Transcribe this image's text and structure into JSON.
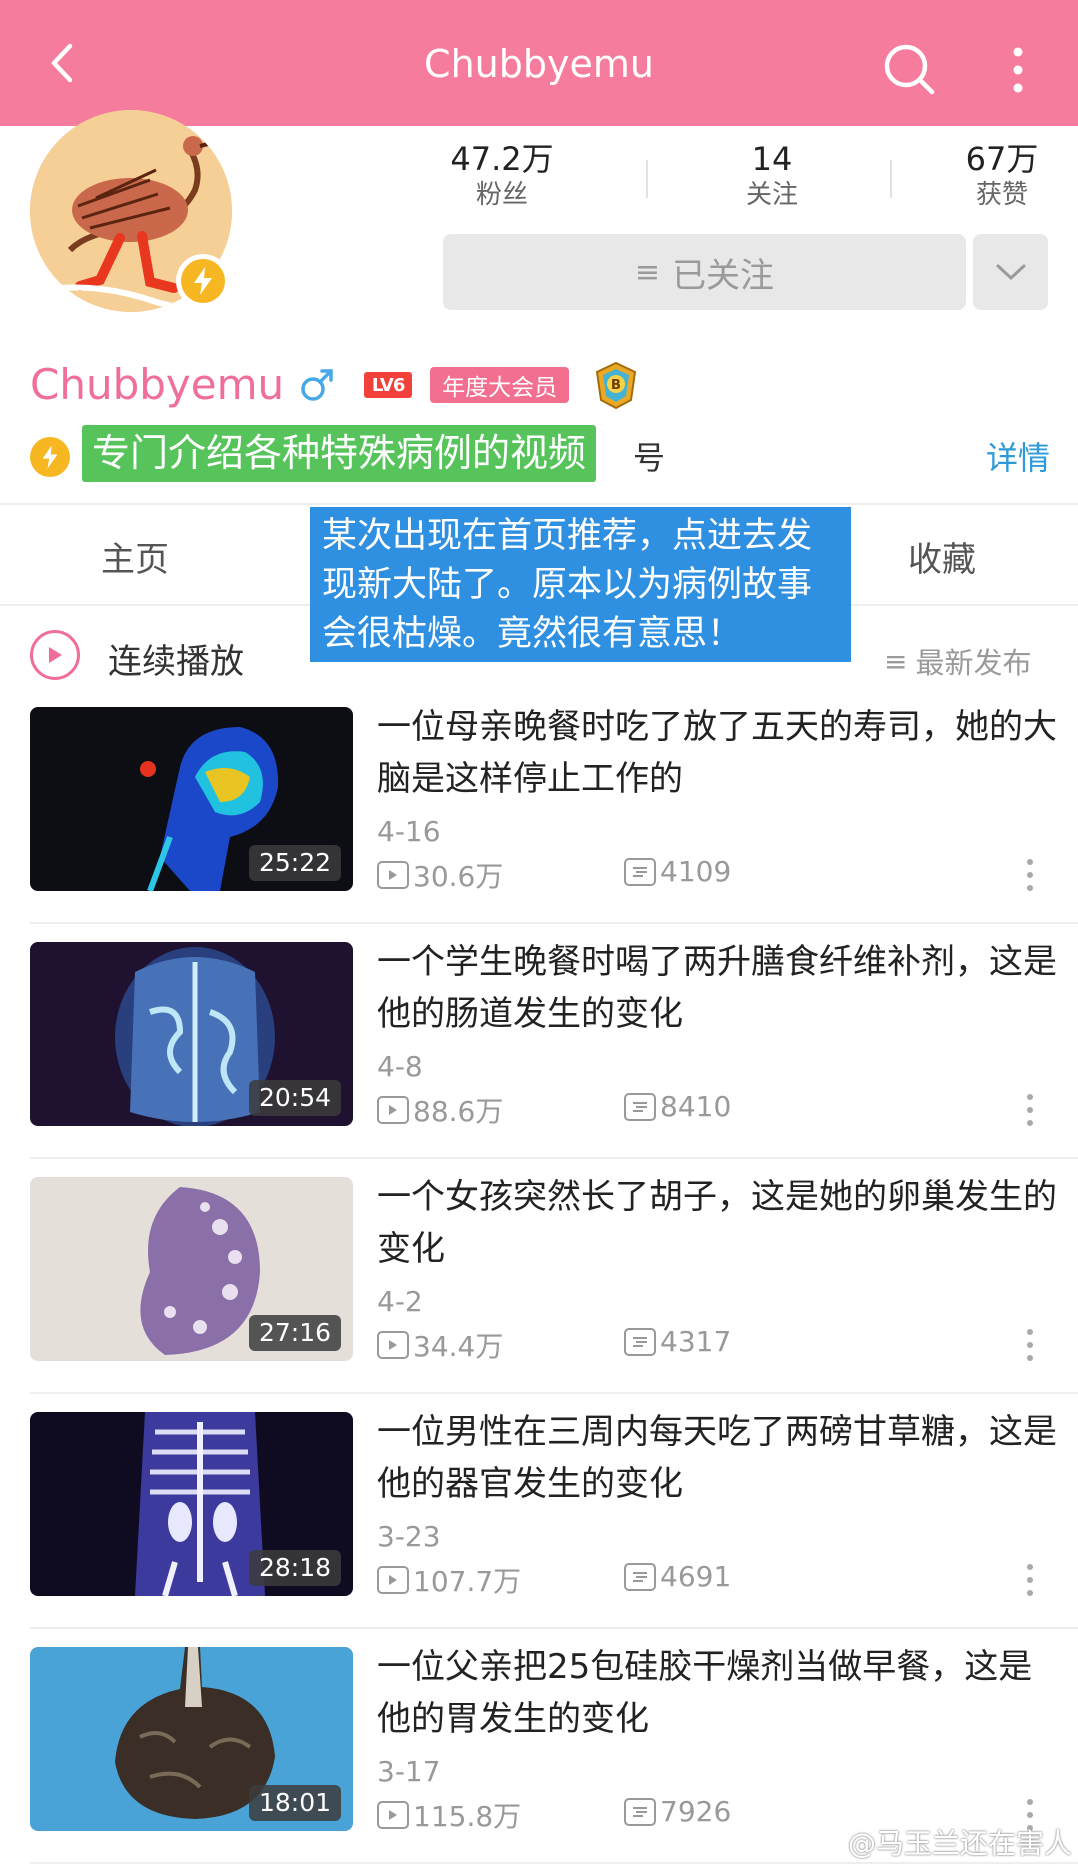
{
  "colors": {
    "brand": "#f67c9d",
    "name": "#ef6f98",
    "link": "#2e9ad7",
    "highlight": "#56c45b",
    "note": "#2f8fe0"
  },
  "topbar": {
    "title": "Chubbyemu",
    "back_icon": "chevron-left",
    "search_icon": "search",
    "more_icon": "more-vertical"
  },
  "stats": [
    {
      "value": "47.2万",
      "label": "粉丝"
    },
    {
      "value": "14",
      "label": "关注"
    },
    {
      "value": "67万",
      "label": "获赞"
    }
  ],
  "follow": {
    "icon": "≡",
    "label": "已关注"
  },
  "profile": {
    "name": "Chubbyemu",
    "gender": "♂",
    "level": "LV6",
    "vip": "年度大会员"
  },
  "sign": {
    "highlight": "专门介绍各种特殊病例的视频",
    "rest": "号",
    "detail": "详情"
  },
  "tabs": [
    {
      "label": "主页"
    },
    {
      "label": "收藏"
    }
  ],
  "note": "某次出现在首页推荐，点进去发现新大陆了。原本以为病例故事会很枯燥。竟然很有意思！",
  "list_header": {
    "play_all": "连续播放",
    "sort_icon": "≡",
    "sort": "最新发布"
  },
  "videos": [
    {
      "title": "一位母亲晚餐时吃了放了五天的寿司，她的大脑是这样停止工作的",
      "date": "4-16",
      "plays": "30.6万",
      "comments": "4109",
      "duration": "25:22"
    },
    {
      "title": "一个学生晚餐时喝了两升膳食纤维补剂，这是他的肠道发生的变化",
      "date": "4-8",
      "plays": "88.6万",
      "comments": "8410",
      "duration": "20:54"
    },
    {
      "title": "一个女孩突然长了胡子，这是她的卵巢发生的变化",
      "date": "4-2",
      "plays": "34.4万",
      "comments": "4317",
      "duration": "27:16"
    },
    {
      "title": "一位男性在三周内每天吃了两磅甘草糖，这是他的器官发生的变化",
      "date": "3-23",
      "plays": "107.7万",
      "comments": "4691",
      "duration": "28:18"
    },
    {
      "title": "一位父亲把25包硅胶干燥剂当做早餐，这是他的胃发生的变化",
      "date": "3-17",
      "plays": "115.8万",
      "comments": "7926",
      "duration": "18:01"
    }
  ],
  "watermark": "@马玉兰还在害人"
}
